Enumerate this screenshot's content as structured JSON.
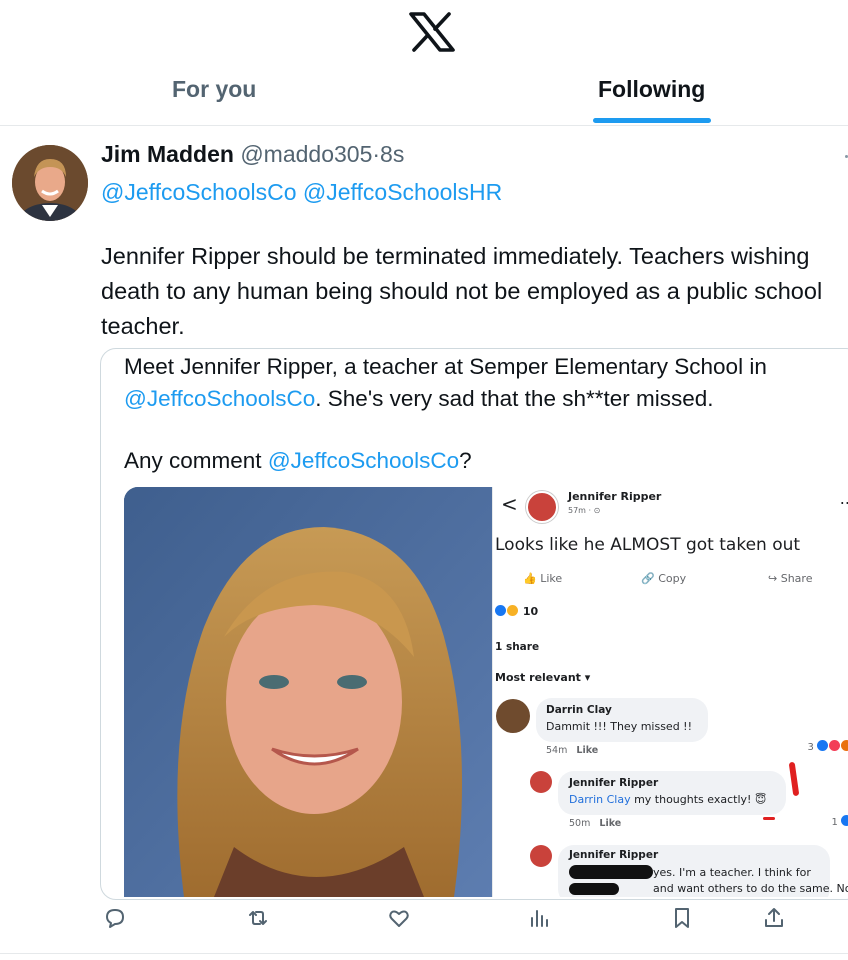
{
  "tabs": [
    {
      "label": "For you"
    },
    {
      "label": "Following"
    }
  ],
  "tweet": {
    "author_name": "Jim Madden",
    "handle": "@maddo305",
    "separator": "·",
    "time": "8s",
    "mentions": [
      "@JeffcoSchoolsCo",
      "@JeffcoSchoolsHR"
    ],
    "text": "Jennifer Ripper should be terminated immediately.  Teachers wishing death to any human being should not be employed as a public school teacher."
  },
  "quote": {
    "line1": "Meet Jennifer Ripper, a teacher at Semper Elementary School in",
    "line2_link": "@JeffcoSchoolsCo",
    "line2_rest": ". She's very sad that the sh**ter missed.",
    "line3_text": "Any comment ",
    "line3_link": "@JeffcoSchoolsCo",
    "line3_end": "?"
  },
  "fb_screenshot": {
    "back_glyph": "<",
    "poster_name": "Jennifer Ripper",
    "post_meta": "57m · ⊙",
    "more": "...",
    "post_text": "Looks like he ALMOST got taken out",
    "like_label": "Like",
    "copy_label": "Copy",
    "share_label": "Share",
    "reaction_count": "10",
    "shares": "1 share",
    "sort": "Most relevant ▾",
    "comment1": {
      "name": "Darrin Clay",
      "text": "Dammit !!! They missed !!",
      "time": "54m",
      "like": "Like",
      "count": "3"
    },
    "comment2": {
      "name": "Jennifer Ripper",
      "mention": "Darrin Clay",
      "text": " my thoughts exactly! 😇",
      "time": "50m",
      "like": "Like",
      "count": "1"
    },
    "comment3": {
      "name": "Jennifer Ripper",
      "text1": "yes. I'm a teacher. I think for",
      "text2": "and want others to do the same. No"
    }
  },
  "colors": {
    "accent": "#1d9bf0",
    "text_primary": "#0f1419",
    "text_secondary": "#536471",
    "facebook_blue": "#216fdb",
    "annotation_red": "#e02020"
  },
  "actions": [
    {
      "icon": "reply-icon"
    },
    {
      "icon": "retweet-icon"
    },
    {
      "icon": "like-icon"
    },
    {
      "icon": "views-icon"
    },
    {
      "icon": "bookmark-icon"
    },
    {
      "icon": "share-icon"
    }
  ]
}
